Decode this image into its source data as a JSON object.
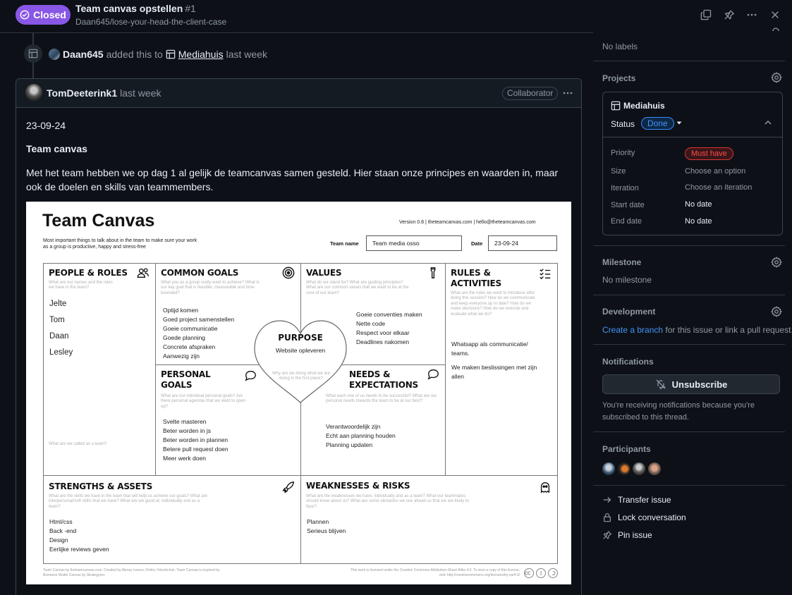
{
  "issue": {
    "state": "Closed",
    "title": "Team canvas opstellen",
    "number": "#1",
    "repo": "Daan645/lose-your-head-the-client-case"
  },
  "timeline": {
    "actor": "Daan645",
    "action": "added this to",
    "project": "Mediahuis",
    "time": "last week"
  },
  "comment": {
    "author": "TomDeeterink1",
    "time": "last week",
    "role": "Collaborator",
    "date": "23-09-24",
    "heading": "Team canvas",
    "paragraph": "Met het team hebben we op dag 1 al gelijk de teamcanvas samen gesteld. Hier staan onze principes en waarden in, maar ook de doelen en skills van teammembers."
  },
  "canvas": {
    "title": "Team Canvas",
    "subtitle": "Most important things to talk about in the team to make sure your work as a group is productive, happy and stress-free",
    "version": "Version 0.8  |  theteamcanvas.com  |  hello@theteamcanvas.com",
    "team_name_label": "Team name",
    "team_name": "Team media osso",
    "date_label": "Date",
    "date": "23-09-24",
    "people": {
      "title": "PEOPLE & ROLES",
      "hint": "What are our names and the roles we have in the team?",
      "items": [
        "Jelte",
        "Tom",
        "Daan",
        "Lesley"
      ],
      "bottom_hint": "What are we called as a team?"
    },
    "goals": {
      "title": "COMMON GOALS",
      "hint": "What you as a group really want to achieve? What is our key goal that is feasible, measurable and time-bounded?",
      "items": [
        "Optijd komen",
        "Goed project samenstellen",
        "Goeie communicatie",
        "Goede planning",
        "Concrete afspraken",
        "Aanwezig zijn"
      ]
    },
    "values": {
      "title": "VALUES",
      "hint": "What do we stand for? What are guiding principles? What are our common values that we want to be at the core of our team?",
      "items": [
        "Goeie conventies maken",
        "Nette code",
        "Respect voor elkaar",
        "Deadlines nakomen"
      ]
    },
    "rules": {
      "title_line1": "RULES &",
      "title_line2": "ACTIVITIES",
      "hint": "What are the rules we want to introduce after doing this session? How do we communicate and keep everyone up to date? How do we make decisions? How do we execute and evaluate what we do?",
      "items": [
        "Whatsapp als communicatie/",
        "teams.",
        "",
        "We maken beslissingen met zijn",
        "allen"
      ]
    },
    "personal": {
      "title_line1": "PERSONAL",
      "title_line2": "GOALS",
      "hint": "What are our individual personal goals? Are there personal agendas that we want to open up?",
      "items": [
        "Svelte masteren",
        "Beter worden in js",
        "Beter worden in plannen",
        "Betere pull request doen",
        "Meer werk doen"
      ]
    },
    "needs": {
      "title_line1": "NEEDS &",
      "title_line2": "EXPECTATIONS",
      "hint": "What each one of us needs to be successful? What are our personal needs towards the team to be at our best?",
      "items": [
        "Verantwoordelijk zijn",
        "Echt aan planning houden",
        "Planning updaten"
      ]
    },
    "purpose": {
      "title": "PURPOSE",
      "value": "Website opleveren",
      "hint": "Why are we doing what we are doing in the first place?"
    },
    "strengths": {
      "title": "STRENGTHS & ASSETS",
      "hint": "What are the skills we have in the team that will help us achieve our goals? What are interpersonal/soft skills that we have? What are we good at, individually and as a team?",
      "items": [
        "Html/css",
        "Back -end",
        "Design",
        "Eerlijke reviews geven"
      ]
    },
    "weaknesses": {
      "title": "WEAKNESSES & RISKS",
      "hint": "What are the weaknesses we have, individually and as a team? What our teammates should know about us? What are some obstacles we see ahead us that we are likely to face?",
      "items": [
        "Plannen",
        "Serieus blijven"
      ]
    },
    "footer_left": "Team Canvas by theteamcanvas.com. Created by Alexey Ivanov, Dmitry Voloshchuk. Team Canvas is inspired by Business Model Canvas by Strategyzer.",
    "footer_right": "This work is licensed under the Creative Commons Attribution-Share Alike 4.0. To view a copy of this license, visit: http://creativecommons.org/licenses/by-sa/4.0/"
  },
  "sidebar": {
    "labels_value": "No labels",
    "projects_heading": "Projects",
    "project_name": "Mediahuis",
    "status_label": "Status",
    "status_value": "Done",
    "fields": [
      {
        "label": "Priority",
        "value": "Must have"
      },
      {
        "label": "Size",
        "value": "Choose an option"
      },
      {
        "label": "Iteration",
        "value": "Choose an iteration"
      },
      {
        "label": "Start date",
        "value": "No date"
      },
      {
        "label": "End date",
        "value": "No date"
      }
    ],
    "milestone_heading": "Milestone",
    "milestone_value": "No milestone",
    "development_heading": "Development",
    "development_link": "Create a branch",
    "development_text": " for this issue or link a pull request.",
    "notifications_heading": "Notifications",
    "unsubscribe_label": "Unsubscribe",
    "notifications_text": "You're receiving notifications because you're subscribed to this thread.",
    "participants_heading": "Participants",
    "actions": {
      "transfer": "Transfer issue",
      "lock": "Lock conversation",
      "pin": "Pin issue"
    }
  },
  "colors": {
    "closed": "#8957e5",
    "link": "#4493f8",
    "danger": "#f85149",
    "background": "#0d1117"
  }
}
